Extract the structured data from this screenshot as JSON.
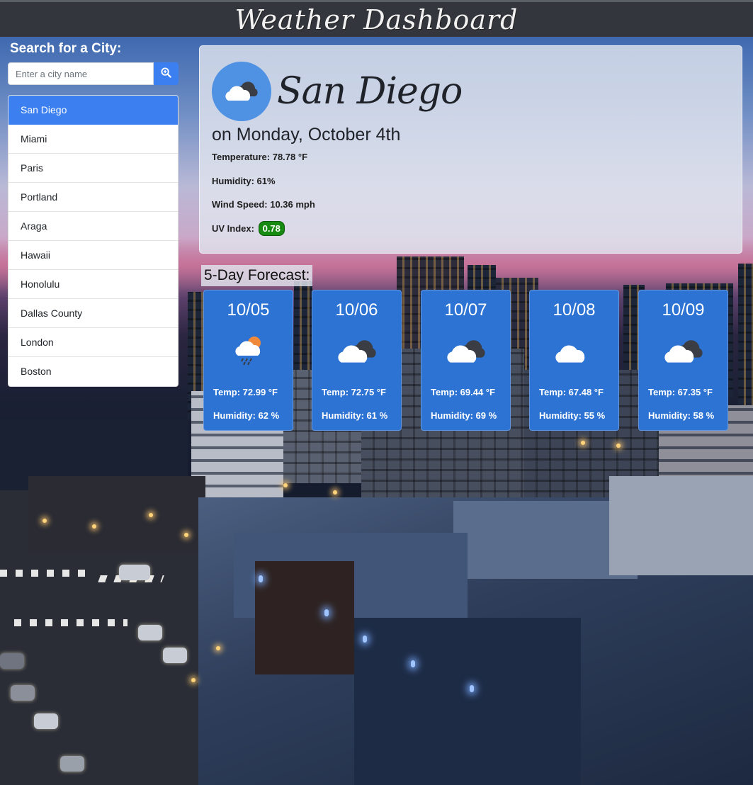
{
  "header": {
    "title": "Weather Dashboard"
  },
  "sidebar": {
    "heading": "Search for a City:",
    "search_placeholder": "Enter a city name",
    "search_value": "",
    "search_button_icon": "search-zoom-icon",
    "cities": [
      "San Diego",
      "Miami",
      "Paris",
      "Portland",
      "Araga",
      "Hawaii",
      "Honolulu",
      "Dallas County",
      "London",
      "Boston"
    ],
    "active_city": "San Diego"
  },
  "current": {
    "city": "San Diego",
    "date_line": "on Monday, October 4th",
    "icon": "cloudy-icon",
    "temperature": "Temperature: 78.78 °F",
    "humidity": "Humidity: 61%",
    "wind": "Wind Speed: 10.36 mph",
    "uv_label": "UV Index:",
    "uv_value": "0.78",
    "uv_color": "#178a12"
  },
  "forecast": {
    "title": "5-Day Forecast:",
    "days": [
      {
        "date": "10/05",
        "icon": "rain-sun-cloud-icon",
        "temp": "Temp: 72.99 °F",
        "humidity": "Humidity: 62 %"
      },
      {
        "date": "10/06",
        "icon": "cloudy-icon",
        "temp": "Temp: 72.75 °F",
        "humidity": "Humidity: 61 %"
      },
      {
        "date": "10/07",
        "icon": "cloudy-icon",
        "temp": "Temp: 69.44 °F",
        "humidity": "Humidity: 69 %"
      },
      {
        "date": "10/08",
        "icon": "cloud-icon",
        "temp": "Temp: 67.48 °F",
        "humidity": "Humidity: 55 %"
      },
      {
        "date": "10/09",
        "icon": "cloudy-icon",
        "temp": "Temp: 67.35 °F",
        "humidity": "Humidity: 58 %"
      }
    ]
  },
  "colors": {
    "accent": "#3b7ff0",
    "forecast_card": "#2c73d3",
    "header_bg": "#33373d"
  }
}
